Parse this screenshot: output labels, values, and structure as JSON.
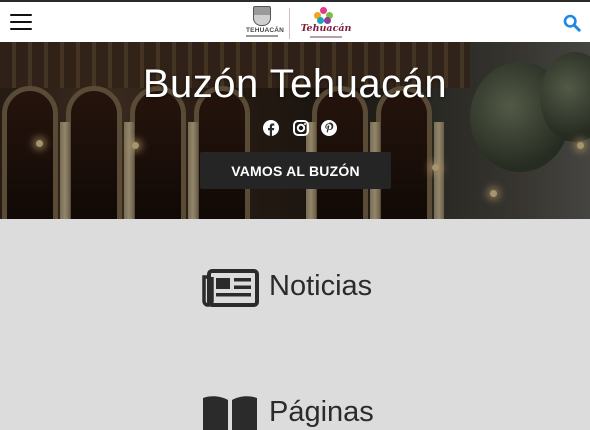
{
  "header": {
    "menu_icon": "hamburger-menu-icon",
    "search_icon": "search-icon",
    "logo_government_text": "TEHUACÁN",
    "logo_brand_text": "Tehuacán",
    "accent_color": "#1e88e5"
  },
  "hero": {
    "title": "Buzón Tehuacán",
    "socials": [
      {
        "icon": "facebook-icon"
      },
      {
        "icon": "instagram-icon"
      },
      {
        "icon": "pinterest-icon"
      }
    ],
    "cta_label": "VAMOS AL BUZÓN"
  },
  "sections": [
    {
      "icon": "newspaper-icon",
      "label": "Noticias"
    },
    {
      "icon": "book-icon",
      "label": "Páginas"
    }
  ]
}
